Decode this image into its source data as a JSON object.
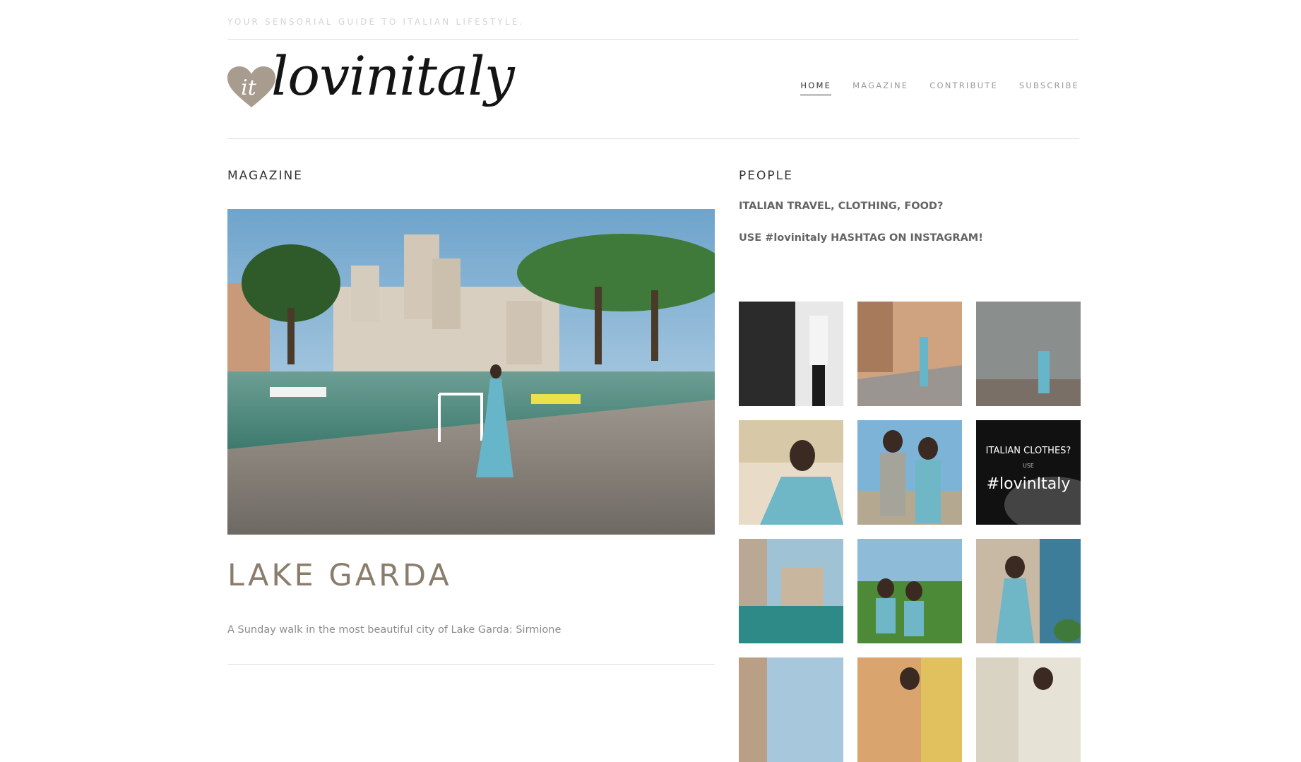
{
  "header": {
    "tagline": "YOUR SENSORIAL GUIDE TO ITALIAN LIFESTYLE.",
    "logo_text": "lovinitaly"
  },
  "nav": {
    "items": [
      {
        "label": "HOME",
        "active": true
      },
      {
        "label": "MAGAZINE",
        "active": false
      },
      {
        "label": "CONTRIBUTE",
        "active": false
      },
      {
        "label": "SUBSCRIBE",
        "active": false
      }
    ]
  },
  "magazine": {
    "section_title": "MAGAZINE",
    "article": {
      "title": "LAKE GARDA",
      "excerpt": "A Sunday walk in the most beautiful city of Lake Garda: Sirmione"
    }
  },
  "people": {
    "section_title": "PEOPLE",
    "line1": "ITALIAN TRAVEL, CLOTHING, FOOD?",
    "line2": "USE #lovinitaly HASHTAG ON INSTAGRAM!",
    "promo": {
      "line1": "ITALIAN CLOTHES?",
      "line2": "USE",
      "line3": "#lovinItaly"
    }
  },
  "colors": {
    "accent": "#8b7d6d",
    "logo_heart": "#a89c8e",
    "muted_text": "#8c8c8c"
  }
}
